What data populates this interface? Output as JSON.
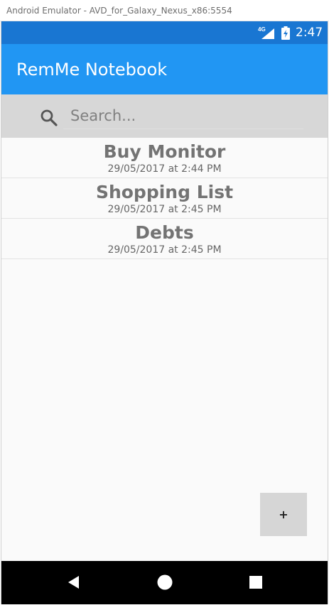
{
  "window": {
    "title": "Android Emulator - AVD_for_Galaxy_Nexus_x86:5554"
  },
  "status_bar": {
    "network_type": "4G",
    "time": "2:47"
  },
  "app_bar": {
    "title": "RemMe Notebook"
  },
  "search": {
    "placeholder": "Search...",
    "value": ""
  },
  "notes": [
    {
      "title": "Buy Monitor",
      "date": "29/05/2017 at 2:44 PM"
    },
    {
      "title": "Shopping List",
      "date": "29/05/2017 at 2:45 PM"
    },
    {
      "title": "Debts",
      "date": "29/05/2017 at 2:45 PM"
    }
  ],
  "fab": {
    "label": "+"
  },
  "nav_bar": {
    "icons": [
      "back-icon",
      "home-icon",
      "recents-icon"
    ]
  },
  "colors": {
    "status_bar": "#1976d2",
    "app_bar": "#2196f3",
    "search_bar": "#d7d7d7",
    "background": "#fafafa",
    "fab": "#d6d6d6",
    "nav_bar": "#000000"
  }
}
